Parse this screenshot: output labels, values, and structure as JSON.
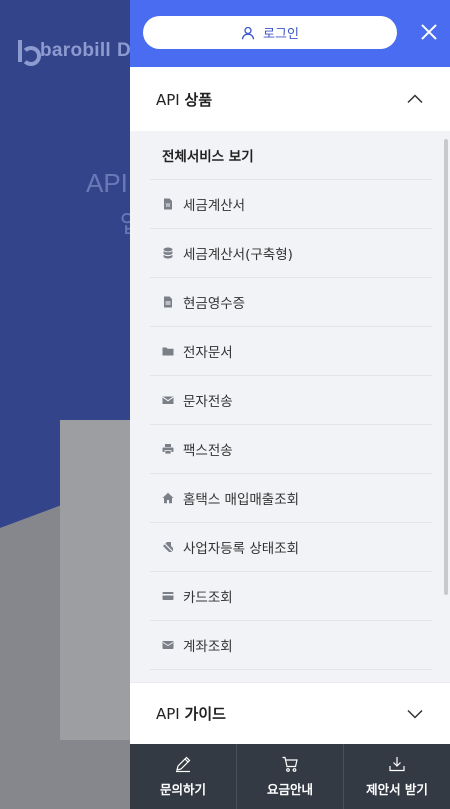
{
  "background": {
    "logo_text": "barobill",
    "logo_suffix": "D",
    "hero_title": "API",
    "hero_sub": "업"
  },
  "drawer": {
    "login_label": "로그인",
    "section1": {
      "title_prefix": "API",
      "title_main": "상품",
      "items": [
        {
          "label": "전체서비스 보기",
          "icon": ""
        },
        {
          "label": "세금계산서",
          "icon": "document-w-icon"
        },
        {
          "label": "세금계산서(구축형)",
          "icon": "database-icon"
        },
        {
          "label": "현금영수증",
          "icon": "receipt-icon"
        },
        {
          "label": "전자문서",
          "icon": "folder-icon"
        },
        {
          "label": "문자전송",
          "icon": "envelope-icon"
        },
        {
          "label": "팩스전송",
          "icon": "printer-icon"
        },
        {
          "label": "홈택스 매입매출조회",
          "icon": "home-icon"
        },
        {
          "label": "사업자등록 상태조회",
          "icon": "tag-slash-icon"
        },
        {
          "label": "카드조회",
          "icon": "card-icon"
        },
        {
          "label": "계좌조회",
          "icon": "bank-envelope-icon"
        }
      ]
    },
    "section2": {
      "title_prefix": "API",
      "title_main": "가이드"
    }
  },
  "bottom_bar": {
    "items": [
      {
        "label": "문의하기",
        "icon": "pencil-icon"
      },
      {
        "label": "요금안내",
        "icon": "cart-icon"
      },
      {
        "label": "제안서 받기",
        "icon": "download-icon"
      }
    ]
  },
  "colors": {
    "header_blue": "#4a6cf0",
    "hero_blue": "#33448b",
    "bottom_bar": "#343a44",
    "submenu_bg": "#f2f3f6"
  }
}
